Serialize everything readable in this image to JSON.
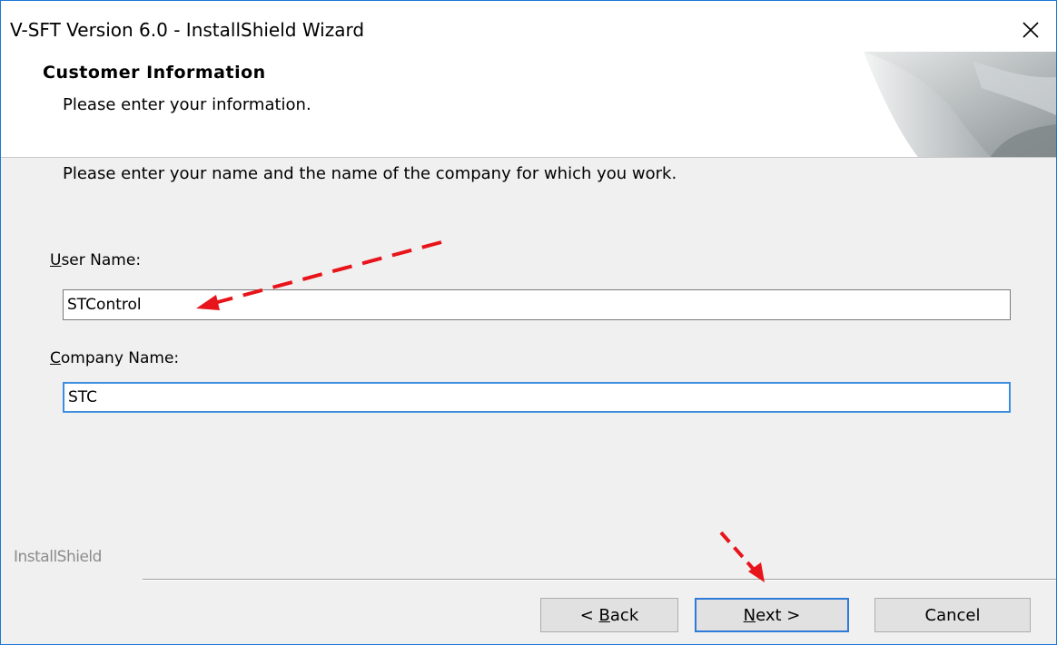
{
  "window": {
    "title": "V-SFT Version 6.0 - InstallShield Wizard",
    "close_glyph": "✕"
  },
  "header": {
    "title": "Customer Information",
    "subtitle": "Please enter your information."
  },
  "main": {
    "instruction": "Please enter your name and the name of the company for which you work.",
    "user_name": {
      "label_accel": "U",
      "label_rest": "ser Name:",
      "value": "STControl"
    },
    "company_name": {
      "label_accel": "C",
      "label_rest": "ompany Name:",
      "value": "STC"
    }
  },
  "footer": {
    "brand": "InstallShield",
    "back": {
      "prefix": "< ",
      "accel": "B",
      "rest": "ack"
    },
    "next": {
      "accel": "N",
      "rest": "ext >"
    },
    "cancel": "Cancel"
  },
  "annotations": {
    "arrow_color": "#e8141b"
  },
  "colors": {
    "focus_border": "#3c8de0",
    "window_border": "#1a77d4",
    "dialog_bg": "#f0f0f0"
  }
}
